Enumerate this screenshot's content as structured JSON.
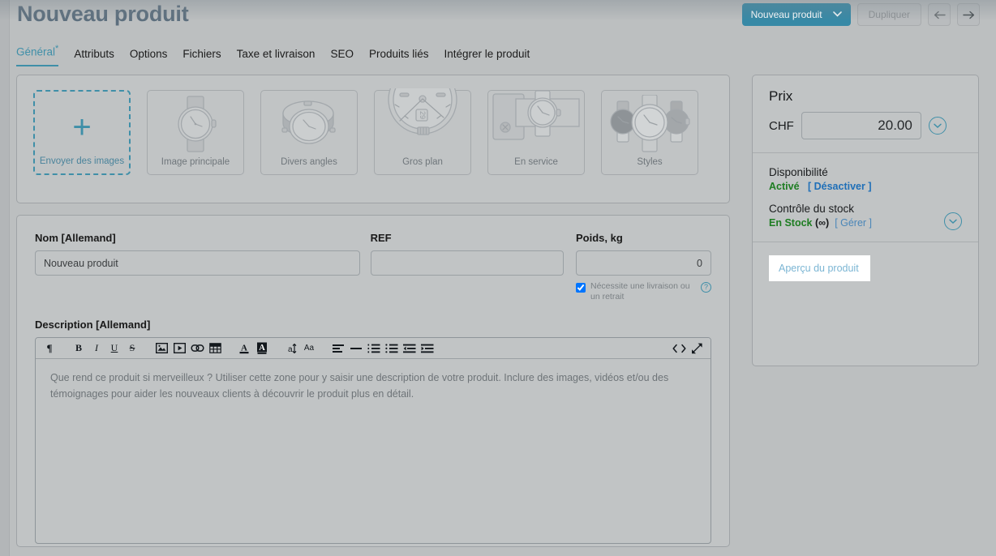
{
  "header": {
    "title": "Nouveau produit",
    "primary_button": "Nouveau produit",
    "primary_chevron": "chevron-down",
    "duplicate_button": "Dupliquer",
    "prev_arrow": "←",
    "next_arrow": "→"
  },
  "tabs": [
    {
      "label": "Général",
      "star": "*",
      "active": true
    },
    {
      "label": "Attributs",
      "star": "",
      "active": false
    },
    {
      "label": "Options",
      "star": "",
      "active": false
    },
    {
      "label": "Fichiers",
      "star": "",
      "active": false
    },
    {
      "label": "Taxe et livraison",
      "star": "",
      "active": false
    },
    {
      "label": "SEO",
      "star": "",
      "active": false
    },
    {
      "label": "Produits liés",
      "star": "",
      "active": false
    },
    {
      "label": "Intégrer le produit",
      "star": "",
      "active": false
    }
  ],
  "media": {
    "thumbs": [
      {
        "caption": "Envoyer des images",
        "type": "upload",
        "icon": "plus-icon"
      },
      {
        "caption": "Image principale",
        "type": "watch-front",
        "icon": "watch-front-icon"
      },
      {
        "caption": "Divers angles",
        "type": "watch-angle",
        "icon": "watch-angle-icon"
      },
      {
        "caption": "Gros plan",
        "type": "watch-closeup",
        "icon": "watch-closeup-icon"
      },
      {
        "caption": "En service",
        "type": "watch-inuse",
        "icon": "watch-inuse-icon"
      },
      {
        "caption": "Styles",
        "type": "watch-styles",
        "icon": "watch-styles-icon"
      }
    ]
  },
  "form": {
    "name_label": "Nom [Allemand]",
    "name_value": "Nouveau produit",
    "ref_label": "REF",
    "ref_value": "",
    "ref_placeholder": "",
    "weight_label": "Poids, kg",
    "weight_value": "0",
    "shipping_checkbox_label": "Nécessite une livraison ou un retrait",
    "shipping_checked": true,
    "help_icon_glyph": "?",
    "description_label": "Description [Allemand]",
    "description_text": "Que rend ce produit si merveilleux ? Utiliser cette zone pour y saisir une description de votre produit. Inclure des images, vidéos et/ou des témoignages pour aider les nouveaux clients à découvrir le produit plus en détail."
  },
  "editor_toolbar": {
    "groups": [
      [
        "paragraph-icon"
      ],
      [
        "bold-icon",
        "italic-icon",
        "underline-icon",
        "strikethrough-icon"
      ],
      [
        "image-icon",
        "video-icon",
        "link-icon",
        "table-icon"
      ],
      [
        "text-color-icon",
        "highlight-color-icon"
      ],
      [
        "line-height-icon",
        "font-size-icon"
      ],
      [
        "align-icon",
        "horizontal-rule-icon",
        "numbered-list-icon",
        "bulleted-list-icon",
        "outdent-icon",
        "indent-icon"
      ]
    ],
    "right": [
      "source-code-icon",
      "fullscreen-icon"
    ]
  },
  "sidebar": {
    "price_heading": "Prix",
    "currency": "CHF",
    "price_value": "20.00",
    "price_expand_icon": "chevron-down-circle-icon",
    "availability_label": "Disponibilité",
    "availability_status": "Activé",
    "availability_action": "[ Désactiver ]",
    "stock_label": "Contrôle du stock",
    "stock_status": "En Stock",
    "stock_qty": "(∞)",
    "stock_action": "[ Gérer ]",
    "stock_expand_icon": "chevron-down-circle-icon",
    "preview_button": "Aperçu du produit"
  },
  "colors": {
    "accent": "#3789a6",
    "accent_light": "#3f8fa8",
    "page_bg": "#bcbfc0",
    "card_bg": "#c1c4c5",
    "title": "#5d6f7e",
    "success": "#1e7d22",
    "link": "#1f6fb8"
  }
}
